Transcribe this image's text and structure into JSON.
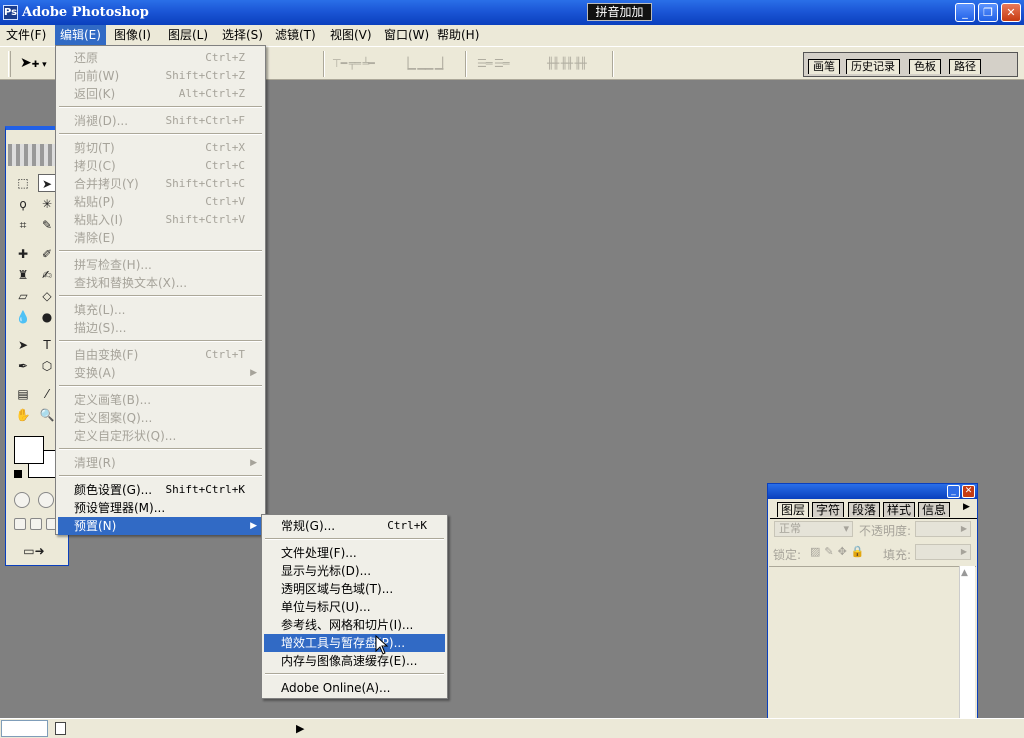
{
  "window": {
    "app_icon": "photoshop-icon",
    "title": "Adobe Photoshop",
    "ime_text": "拼音加加"
  },
  "menubar": [
    {
      "label": "文件(F)"
    },
    {
      "label": "编辑(E)",
      "active": true
    },
    {
      "label": "图像(I)"
    },
    {
      "label": "图层(L)"
    },
    {
      "label": "选择(S)"
    },
    {
      "label": "滤镜(T)"
    },
    {
      "label": "视图(V)"
    },
    {
      "label": "窗口(W)"
    },
    {
      "label": "帮助(H)"
    }
  ],
  "palette_well_tabs": [
    "画笔",
    "历史记录",
    "色板",
    "路径"
  ],
  "edit_menu": {
    "items": [
      {
        "label": "还原",
        "shortcut": "Ctrl+Z",
        "disabled": true
      },
      {
        "label": "向前(W)",
        "shortcut": "Shift+Ctrl+Z",
        "disabled": true
      },
      {
        "label": "返回(K)",
        "shortcut": "Alt+Ctrl+Z",
        "disabled": true
      },
      {
        "label": "消褪(D)...",
        "shortcut": "Shift+Ctrl+F",
        "disabled": true
      },
      {
        "label": "剪切(T)",
        "shortcut": "Ctrl+X",
        "disabled": true
      },
      {
        "label": "拷贝(C)",
        "shortcut": "Ctrl+C",
        "disabled": true
      },
      {
        "label": "合并拷贝(Y)",
        "shortcut": "Shift+Ctrl+C",
        "disabled": true
      },
      {
        "label": "粘贴(P)",
        "shortcut": "Ctrl+V",
        "disabled": true
      },
      {
        "label": "粘贴入(I)",
        "shortcut": "Shift+Ctrl+V",
        "disabled": true
      },
      {
        "label": "清除(E)",
        "shortcut": "",
        "disabled": true
      },
      {
        "label": "拼写检查(H)...",
        "shortcut": "",
        "disabled": true
      },
      {
        "label": "查找和替换文本(X)...",
        "shortcut": "",
        "disabled": true
      },
      {
        "label": "填充(L)...",
        "shortcut": "",
        "disabled": true
      },
      {
        "label": "描边(S)...",
        "shortcut": "",
        "disabled": true
      },
      {
        "label": "自由变换(F)",
        "shortcut": "Ctrl+T",
        "disabled": true
      },
      {
        "label": "变换(A)",
        "shortcut": "",
        "disabled": true,
        "submenu": true
      },
      {
        "label": "定义画笔(B)...",
        "shortcut": "",
        "disabled": true
      },
      {
        "label": "定义图案(Q)...",
        "shortcut": "",
        "disabled": true
      },
      {
        "label": "定义自定形状(Q)...",
        "shortcut": "",
        "disabled": true
      },
      {
        "label": "清理(R)",
        "shortcut": "",
        "disabled": true,
        "submenu": true
      },
      {
        "label": "颜色设置(G)...",
        "shortcut": "Shift+Ctrl+K",
        "disabled": false
      },
      {
        "label": "预设管理器(M)...",
        "shortcut": "",
        "disabled": false
      },
      {
        "label": "预置(N)",
        "shortcut": "",
        "disabled": false,
        "submenu": true,
        "highlighted": true
      }
    ]
  },
  "preferences_menu": {
    "items": [
      {
        "label": "常规(G)...",
        "shortcut": "Ctrl+K"
      },
      {
        "label": "文件处理(F)...",
        "shortcut": ""
      },
      {
        "label": "显示与光标(D)...",
        "shortcut": ""
      },
      {
        "label": "透明区域与色域(T)...",
        "shortcut": ""
      },
      {
        "label": "单位与标尺(U)...",
        "shortcut": ""
      },
      {
        "label": "参考线、网格和切片(I)...",
        "shortcut": ""
      },
      {
        "label": "增效工具与暂存盘(P)...",
        "shortcut": "",
        "highlighted": true
      },
      {
        "label": "内存与图像高速缓存(E)...",
        "shortcut": ""
      },
      {
        "label": "Adobe Online(A)...",
        "shortcut": ""
      }
    ]
  },
  "layers_panel": {
    "tabs": [
      "图层",
      "字符",
      "段落",
      "样式",
      "信息"
    ],
    "blend_mode": "正常",
    "opacity_label": "不透明度:",
    "lock_label": "锁定:",
    "fill_label": "填充:"
  },
  "colors": {
    "menu_highlight": "#316ac5",
    "workspace": "#808080",
    "chrome": "#ece9d8"
  }
}
